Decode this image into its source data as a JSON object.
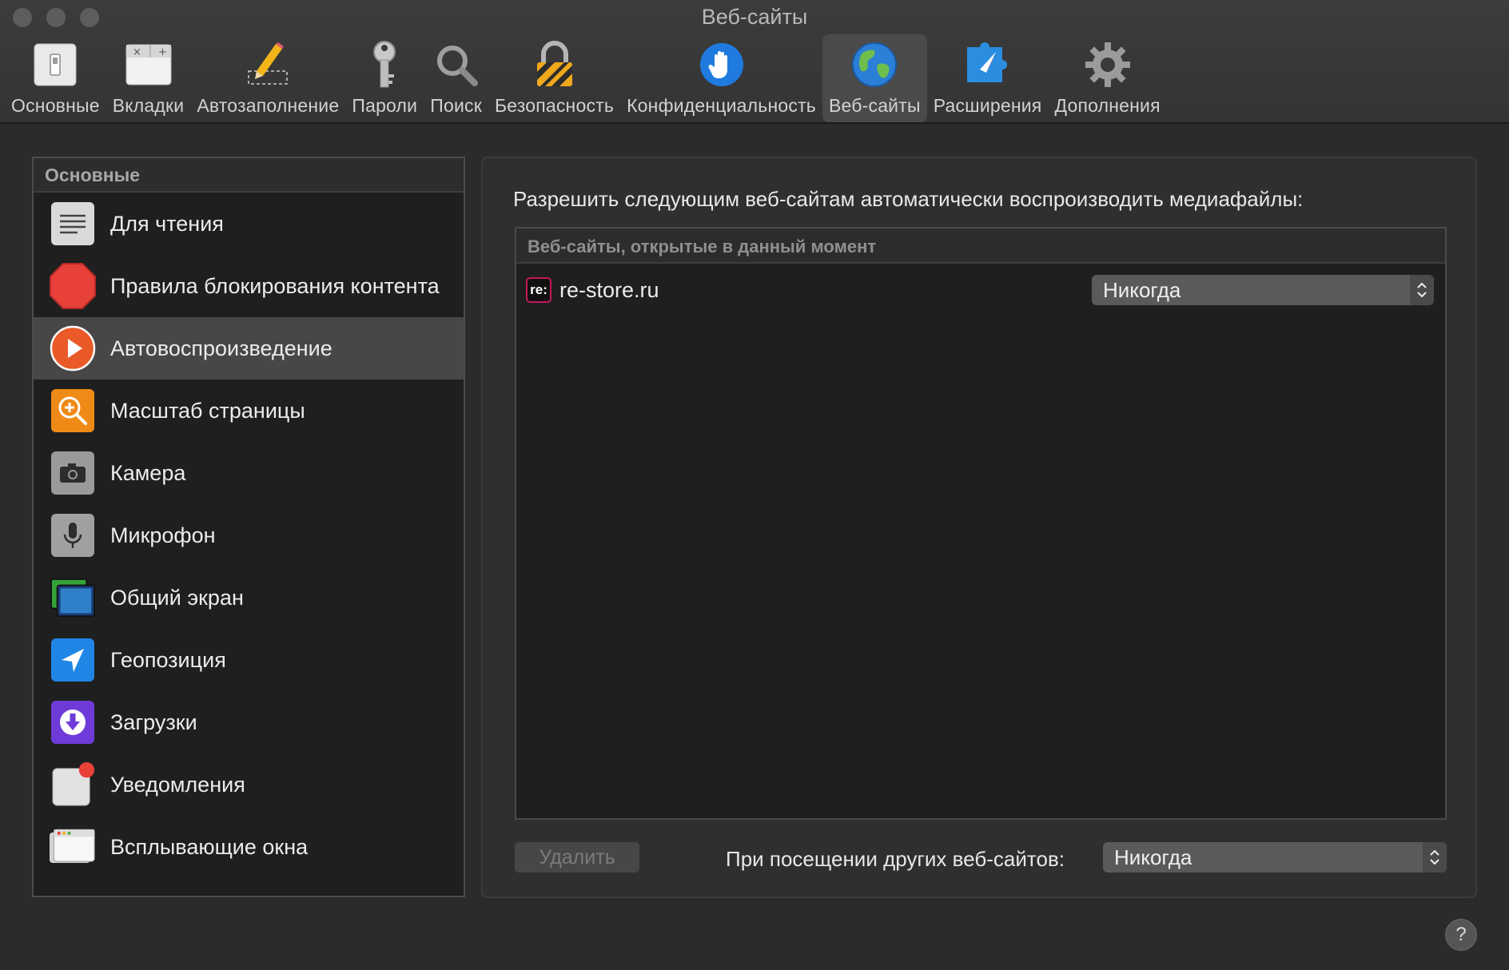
{
  "window": {
    "title": "Веб-сайты"
  },
  "toolbar": {
    "items": [
      {
        "label": "Основные",
        "icon": "general-icon"
      },
      {
        "label": "Вкладки",
        "icon": "tabs-icon"
      },
      {
        "label": "Автозаполнение",
        "icon": "autofill-pencil-icon"
      },
      {
        "label": "Пароли",
        "icon": "key-icon"
      },
      {
        "label": "Поиск",
        "icon": "magnifier-icon"
      },
      {
        "label": "Безопасность",
        "icon": "lock-icon"
      },
      {
        "label": "Конфиденциальность",
        "icon": "hand-icon"
      },
      {
        "label": "Веб-сайты",
        "icon": "globe-icon",
        "active": true
      },
      {
        "label": "Расширения",
        "icon": "puzzle-compass-icon"
      },
      {
        "label": "Дополнения",
        "icon": "gear-icon"
      }
    ]
  },
  "sidebar": {
    "header": "Основные",
    "items": [
      {
        "label": "Для чтения",
        "icon": "reader-icon"
      },
      {
        "label": "Правила блокирования контента",
        "icon": "stop-sign-icon"
      },
      {
        "label": "Автовоспроизведение",
        "icon": "play-icon",
        "selected": true
      },
      {
        "label": "Масштаб страницы",
        "icon": "zoom-icon"
      },
      {
        "label": "Камера",
        "icon": "camera-icon"
      },
      {
        "label": "Микрофон",
        "icon": "microphone-icon"
      },
      {
        "label": "Общий экран",
        "icon": "screen-share-icon"
      },
      {
        "label": "Геопозиция",
        "icon": "location-arrow-icon"
      },
      {
        "label": "Загрузки",
        "icon": "download-icon"
      },
      {
        "label": "Уведомления",
        "icon": "notification-icon"
      },
      {
        "label": "Всплывающие окна",
        "icon": "popup-window-icon"
      }
    ]
  },
  "main": {
    "heading": "Разрешить следующим веб-сайтам автоматически воспроизводить медиафайлы:",
    "table_header": "Веб-сайты, открытые в данный момент",
    "sites": [
      {
        "favicon_text": "re:",
        "name": "re-store.ru",
        "setting": "Никогда"
      }
    ],
    "delete_label": "Удалить",
    "other_sites_label": "При посещении других веб-сайтов:",
    "other_sites_value": "Никогда"
  },
  "help": {
    "label": "?"
  },
  "colors": {
    "accent_blue": "#1f7ae0",
    "selection": "#474747",
    "favicon_border": "#c2185b"
  }
}
